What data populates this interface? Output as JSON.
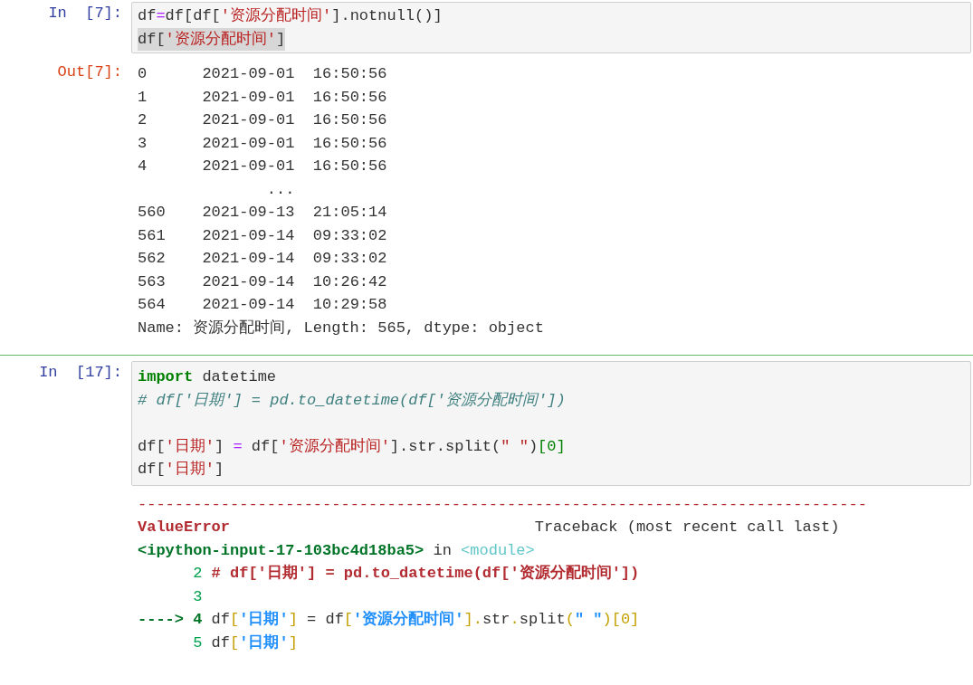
{
  "cell_1": {
    "prompt": "In  [7]:",
    "code_lines": [
      {
        "highlighted": false,
        "segments": [
          {
            "kind": "plain",
            "text": "df"
          },
          {
            "kind": "operator",
            "text": "="
          },
          {
            "kind": "plain",
            "text": "df[df["
          },
          {
            "kind": "string",
            "text": "'资源分配时间'"
          },
          {
            "kind": "plain",
            "text": "].notnull()]"
          }
        ]
      },
      {
        "highlighted": true,
        "segments": [
          {
            "kind": "plain",
            "text": "df["
          },
          {
            "kind": "string",
            "text": "'资源分配时间'"
          },
          {
            "kind": "plain",
            "text": "]"
          }
        ]
      }
    ]
  },
  "output_1": {
    "prompt": "Out[7]:",
    "lines": [
      "0      2021-09-01  16:50:56",
      "1      2021-09-01  16:50:56",
      "2      2021-09-01  16:50:56",
      "3      2021-09-01  16:50:56",
      "4      2021-09-01  16:50:56",
      "              ...",
      "560    2021-09-13  21:05:14",
      "561    2021-09-14  09:33:02",
      "562    2021-09-14  09:33:02",
      "563    2021-09-14  10:26:42",
      "564    2021-09-14  10:29:58",
      "Name: 资源分配时间, Length: 565, dtype: object"
    ]
  },
  "cell_2": {
    "prompt": "In  [17]:",
    "code_lines": [
      {
        "highlighted": false,
        "segments": [
          {
            "kind": "keyword",
            "text": "import"
          },
          {
            "kind": "plain",
            "text": " datetime"
          }
        ]
      },
      {
        "highlighted": false,
        "segments": [
          {
            "kind": "comment",
            "text": "# df['日期'] = pd.to_datetime(df['资源分配时间'])"
          }
        ]
      },
      {
        "kind": "blank"
      },
      {
        "highlighted": false,
        "segments": [
          {
            "kind": "plain",
            "text": "df["
          },
          {
            "kind": "string",
            "text": "'日期'"
          },
          {
            "kind": "plain",
            "text": "] "
          },
          {
            "kind": "operator",
            "text": "="
          },
          {
            "kind": "plain",
            "text": " df["
          },
          {
            "kind": "string",
            "text": "'资源分配时间'"
          },
          {
            "kind": "plain",
            "text": "].str.split("
          },
          {
            "kind": "string",
            "text": "\" \""
          },
          {
            "kind": "plain",
            "text": ")"
          },
          {
            "kind": "number",
            "text": "[0]"
          }
        ]
      },
      {
        "highlighted": false,
        "segments": [
          {
            "kind": "plain",
            "text": "df["
          },
          {
            "kind": "string",
            "text": "'日期'"
          },
          {
            "kind": "plain",
            "text": "]"
          }
        ]
      }
    ]
  },
  "traceback": {
    "rule": "-------------------------------------------------------------------------------",
    "lines": [
      {
        "indented": false,
        "segments": [
          {
            "kind": "error",
            "text": "ValueError"
          },
          {
            "kind": "plain",
            "text": "                                 Traceback (most recent call last)"
          }
        ]
      },
      {
        "indented": false,
        "segments": [
          {
            "kind": "file",
            "text": "<ipython-input-17-103bc4d18ba5>"
          },
          {
            "kind": "plain",
            "text": " in "
          },
          {
            "kind": "module",
            "text": "<module>"
          }
        ]
      },
      {
        "indented": true,
        "segments": [
          {
            "kind": "lineno",
            "text": "2"
          },
          {
            "kind": "comment",
            "text": " # df['日期'] = pd.to_datetime(df['资源分配时间'])"
          }
        ]
      },
      {
        "indented": true,
        "segments": [
          {
            "kind": "lineno",
            "text": "3"
          }
        ]
      },
      {
        "indented": false,
        "segments": [
          {
            "kind": "arrow",
            "text": "----> 4"
          },
          {
            "kind": "plain",
            "text": " df"
          },
          {
            "kind": "bracket",
            "text": "["
          },
          {
            "kind": "string",
            "text": "'日期'"
          },
          {
            "kind": "bracket",
            "text": "]"
          },
          {
            "kind": "plain",
            "text": " = df"
          },
          {
            "kind": "bracket",
            "text": "["
          },
          {
            "kind": "string",
            "text": "'资源分配时间'"
          },
          {
            "kind": "bracket",
            "text": "]."
          },
          {
            "kind": "plain",
            "text": "str"
          },
          {
            "kind": "bracket",
            "text": "."
          },
          {
            "kind": "plain",
            "text": "split"
          },
          {
            "kind": "bracket",
            "text": "("
          },
          {
            "kind": "string",
            "text": "\" \""
          },
          {
            "kind": "bracket",
            "text": ")[0]"
          }
        ]
      },
      {
        "indented": true,
        "segments": [
          {
            "kind": "lineno",
            "text": "5"
          },
          {
            "kind": "plain",
            "text": " df"
          },
          {
            "kind": "bracket",
            "text": "["
          },
          {
            "kind": "string",
            "text": "'日期'"
          },
          {
            "kind": "bracket",
            "text": "]"
          }
        ]
      }
    ]
  }
}
